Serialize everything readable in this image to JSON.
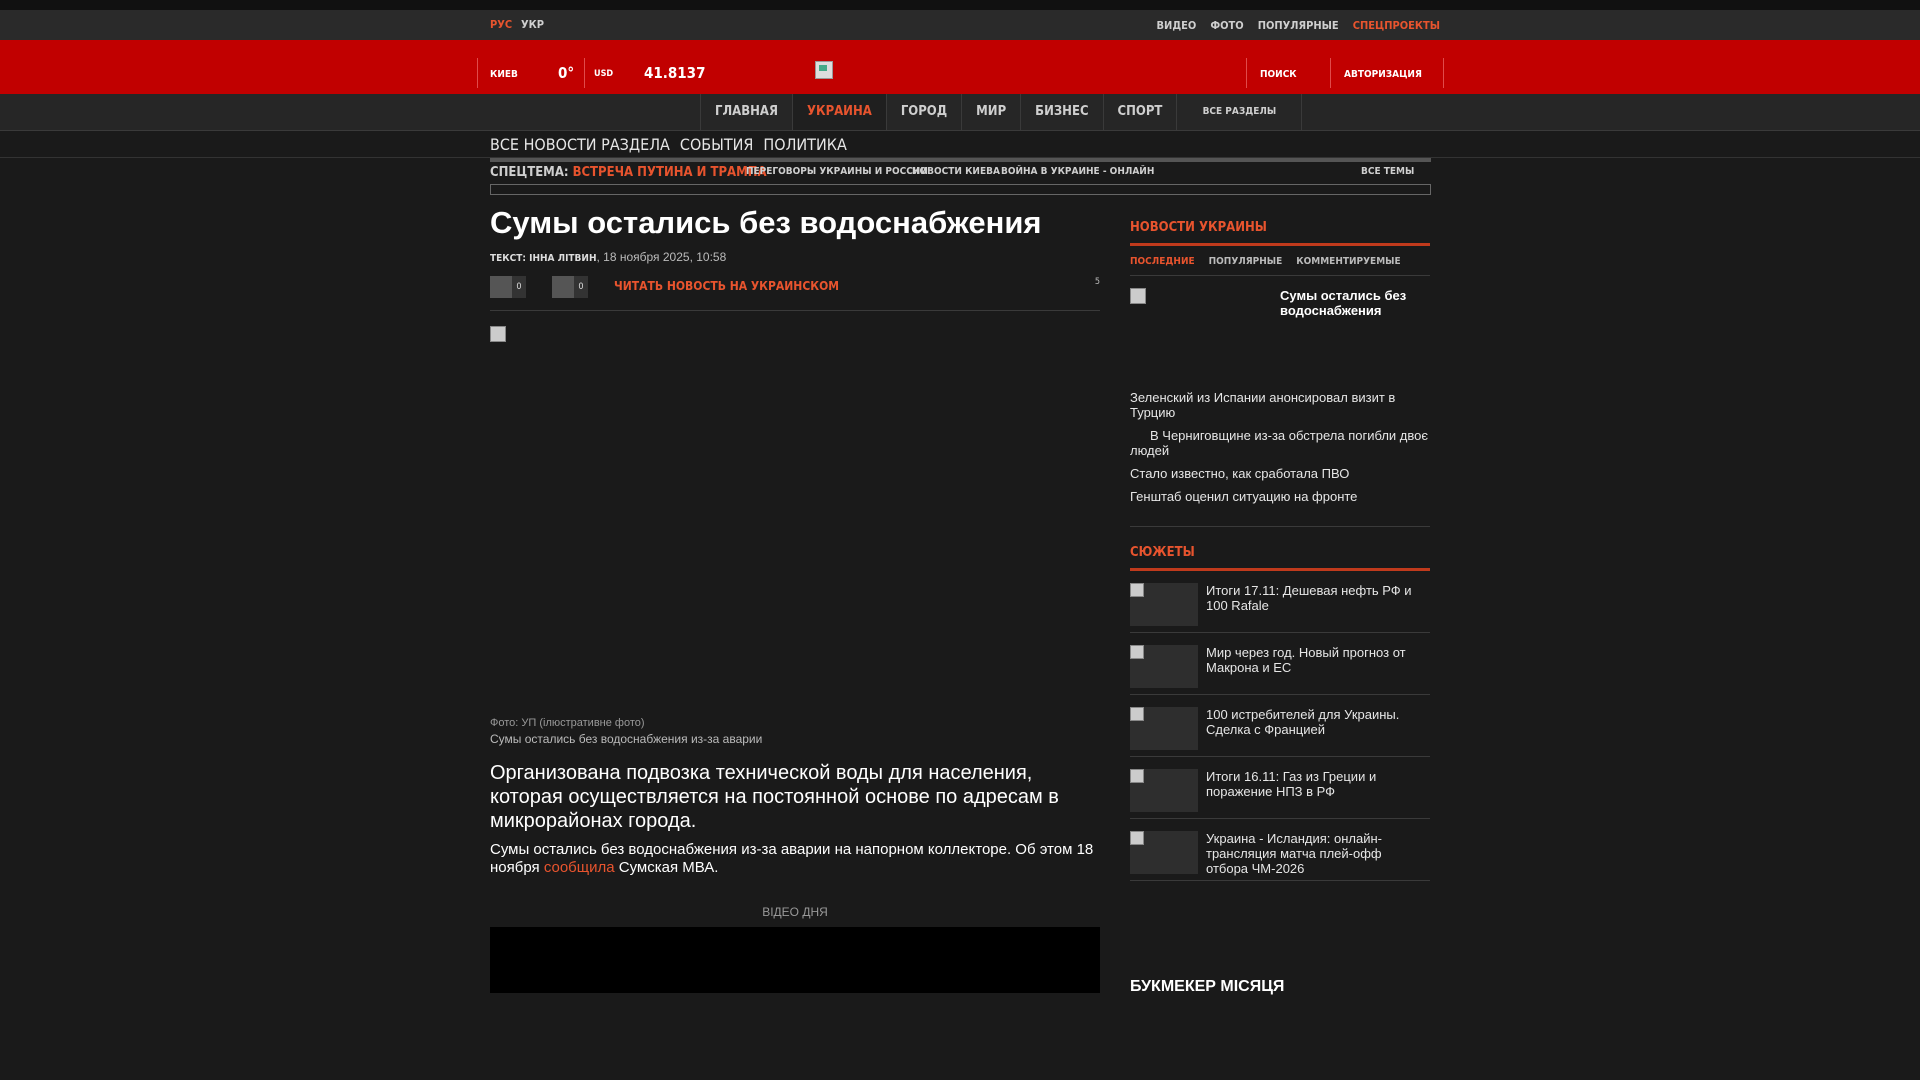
{
  "top_bar": {
    "lang_ru": "РУС",
    "lang_ua": "УКР",
    "right_nav": [
      {
        "label": "ВИДЕО",
        "special": false
      },
      {
        "label": "ФОТО",
        "special": false
      },
      {
        "label": "ПОПУЛЯРНЫЕ",
        "special": false
      },
      {
        "label": "СПЕЦПРОЕКТЫ",
        "special": true
      }
    ]
  },
  "header": {
    "city": "КИЕВ",
    "temperature": "0°",
    "currency": "USD",
    "rate": "41.8137",
    "search": "ПОИСК",
    "auth": "АВТОРИЗАЦИЯ"
  },
  "main_nav": [
    {
      "label": "ГЛАВНАЯ",
      "active": false
    },
    {
      "label": "УКРАИНА",
      "active": true
    },
    {
      "label": "ГОРОД",
      "active": false
    },
    {
      "label": "МИР",
      "active": false
    },
    {
      "label": "БИЗНЕС",
      "active": false
    },
    {
      "label": "СПОРТ",
      "active": false
    }
  ],
  "main_nav_all": "ВСЕ РАЗДЕЛЫ",
  "sub_nav": [
    {
      "label": "ВСЕ НОВОСТИ РАЗДЕЛА",
      "active": true
    },
    {
      "label": "СОБЫТИЯ",
      "active": false
    },
    {
      "label": "ПОЛИТИКА",
      "active": false
    }
  ],
  "topics": {
    "spec_label": "СПЕЦТЕМА:",
    "spec_value": "ВСТРЕЧА ПУТИНА И ТРАМПА",
    "items": [
      "ПЕРЕГОВОРЫ УКРАИНЫ И РОССИИ",
      "НОВОСТИ КИЕВА",
      "ВОЙНА В УКРАИНЕ - ОНЛАЙН"
    ],
    "all": "ВСЕ ТЕМЫ"
  },
  "article": {
    "title": "Сумы остались без водоснабжения",
    "author_label": "ТЕКСТ: ІННА ЛІТВИН",
    "date": "18 ноября 2025, 10:58",
    "share_count_1": "0",
    "share_count_2": "0",
    "read_ua": "ЧИТАТЬ НОВОСТЬ НА УКРАИНСКОМ",
    "comments_count": "5",
    "photo_credit": "Фото: УП (ілюстративне фото)",
    "photo_caption": "Сумы остались без водоснабжения из-за аварии",
    "lead": "Организована подвозка технической воды для населения, которая осуществляется на постоянной основе по адресам в микрорайонах города.",
    "body_before": "Сумы остались без водоснабжения из-за аварии на напорном коллекторе. Об этом 18 ноября ",
    "body_link": "сообщила",
    "body_after": " Сумская МВА.",
    "video_label": "ВІДЕО ДНЯ"
  },
  "sidebar": {
    "heading": "НОВОСТИ УКРАИНЫ",
    "tabs": [
      {
        "label": "ПОСЛЕДНИЕ",
        "active": true
      },
      {
        "label": "ПОПУЛЯРНЫЕ",
        "active": false
      },
      {
        "label": "КОММЕНТИРУЕМЫЕ",
        "active": false
      }
    ],
    "featured_title": "Сумы остались без водоснабжения",
    "news": [
      {
        "title": "Зеленский из Испании анонсировал визит в Турцию",
        "indent": false
      },
      {
        "title": "В Черниговщине из-за обстрела погибли двоє людей",
        "indent": true
      },
      {
        "title": "Стало известно, как сработала ПВО",
        "indent": false
      },
      {
        "title": "Генштаб оценил ситуацию на фронте",
        "indent": false
      }
    ],
    "stories_heading": "СЮЖЕТЫ",
    "stories": [
      "Итоги 17.11: Дешевая нефть РФ и 100 Rafale",
      "Мир через год. Новый прогноз от Макрона и ЕС",
      "100 истребителей для Украины. Сделка с Францией",
      "Итоги 16.11: Газ из Греции и поражение НПЗ в РФ",
      "Украина - Исландия: онлайн-трансляция матча плей-офф отбора ЧМ-2026"
    ],
    "bookmaker": "БУКМЕКЕР МІСЯЦЯ"
  },
  "colors": {
    "accent": "#e8542e",
    "brand_red": "#c10000",
    "background": "#1a1a1a"
  }
}
